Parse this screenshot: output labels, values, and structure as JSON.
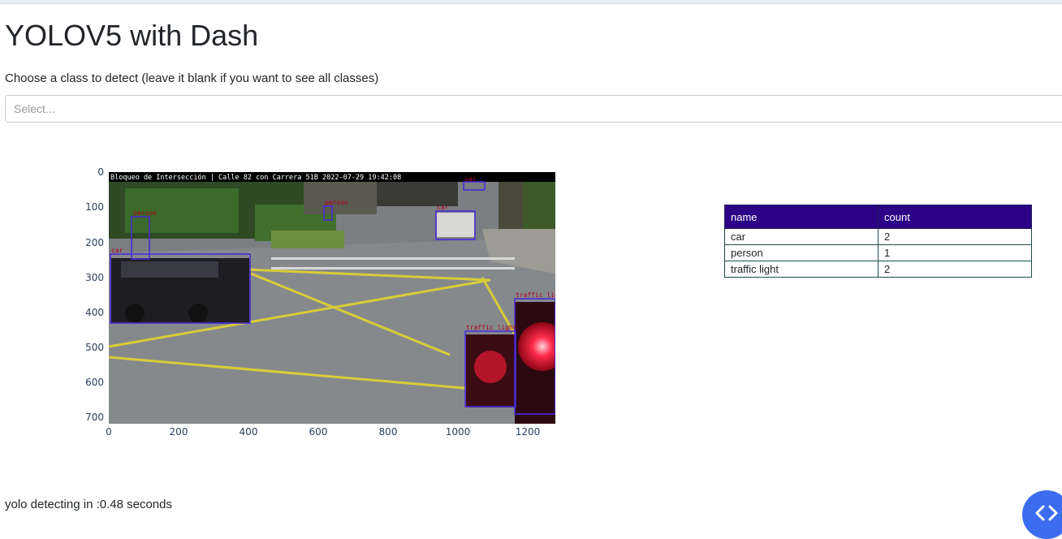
{
  "header": {
    "title": "YOLOV5 with Dash"
  },
  "selector": {
    "label": "Choose a class to detect (leave it blank if you want to see all classes)",
    "placeholder": "Select..."
  },
  "figure": {
    "image_caption": "Bloqueo de Intersección | Calle 82 con Carrera 51B 2022-07-29 19:42:08",
    "yticks": [
      "0",
      "100",
      "200",
      "300",
      "400",
      "500",
      "600",
      "700"
    ],
    "xticks": [
      "0",
      "200",
      "400",
      "600",
      "800",
      "1000",
      "1200"
    ],
    "detections": [
      {
        "label": "car"
      },
      {
        "label": "person"
      },
      {
        "label": "car"
      },
      {
        "label": "person"
      },
      {
        "label": "car"
      },
      {
        "label": "traffic light"
      },
      {
        "label": "traffic light"
      }
    ],
    "box_color": "#4b2bd8",
    "label_color": "#b3001b"
  },
  "table": {
    "headers": [
      "name",
      "count"
    ],
    "rows": [
      [
        "car",
        "2"
      ],
      [
        "person",
        "1"
      ],
      [
        "traffic light",
        "2"
      ]
    ],
    "header_color": "#2c0387"
  },
  "status": {
    "text": "yolo detecting in :0.48 seconds"
  },
  "fab": {
    "icon": "code-icon",
    "color": "#3c6cf0"
  }
}
